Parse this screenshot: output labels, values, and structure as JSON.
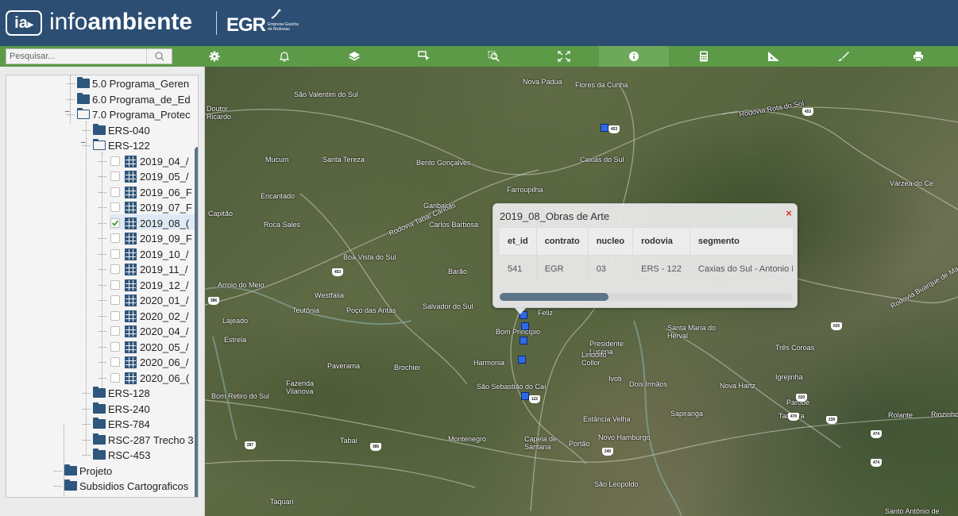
{
  "header": {
    "logo_mark": "ia",
    "brand_light": "info",
    "brand_bold": "ambiente",
    "partner": "EGR",
    "partner_sub": "Empresa Gaúcha de Rodovias"
  },
  "toolbar": {
    "search_placeholder": "Pesquisar...",
    "tools": [
      "gear-icon",
      "bell-icon",
      "layers-icon",
      "select-icon",
      "zoom-area-icon",
      "extent-icon",
      "info-icon",
      "calculator-icon",
      "measure-icon",
      "draw-icon",
      "print-icon"
    ],
    "active_tool": "info-icon"
  },
  "tree": {
    "items": [
      {
        "label": "5.0 Programa_Geren",
        "type": "folder"
      },
      {
        "label": "6.0 Programa_de_Ed",
        "type": "folder"
      },
      {
        "label": "7.0 Programa_Protec",
        "type": "folder-open"
      },
      {
        "label": "ERS-040",
        "type": "folder"
      },
      {
        "label": "ERS-122",
        "type": "folder-open"
      },
      {
        "label": "2019_04_/",
        "type": "layer",
        "checked": false
      },
      {
        "label": "2019_05_/",
        "type": "layer",
        "checked": false
      },
      {
        "label": "2019_06_F",
        "type": "layer",
        "checked": false
      },
      {
        "label": "2019_07_F",
        "type": "layer",
        "checked": false
      },
      {
        "label": "2019_08_(",
        "type": "layer",
        "checked": true
      },
      {
        "label": "2019_09_F",
        "type": "layer",
        "checked": false
      },
      {
        "label": "2019_10_/",
        "type": "layer",
        "checked": false
      },
      {
        "label": "2019_11_/",
        "type": "layer",
        "checked": false
      },
      {
        "label": "2019_12_/",
        "type": "layer",
        "checked": false
      },
      {
        "label": "2020_01_/",
        "type": "layer",
        "checked": false
      },
      {
        "label": "2020_02_/",
        "type": "layer",
        "checked": false
      },
      {
        "label": "2020_04_/",
        "type": "layer",
        "checked": false
      },
      {
        "label": "2020_05_/",
        "type": "layer",
        "checked": false
      },
      {
        "label": "2020_06_/",
        "type": "layer",
        "checked": false
      },
      {
        "label": "2020_06_(",
        "type": "layer",
        "checked": false
      },
      {
        "label": "ERS-128",
        "type": "folder"
      },
      {
        "label": "ERS-240",
        "type": "folder"
      },
      {
        "label": "ERS-784",
        "type": "folder"
      },
      {
        "label": "RSC-287 Trecho 3",
        "type": "folder"
      },
      {
        "label": "RSC-453",
        "type": "folder"
      },
      {
        "label": "Projeto",
        "type": "folder"
      },
      {
        "label": "Subsidios Cartograficos",
        "type": "folder"
      }
    ]
  },
  "map": {
    "places": [
      "Nova Pádua",
      "Flores da Cunha",
      "Doutor Ricardo",
      "São Valentim do Sul",
      "Rodovia Rota do Sol",
      "Caxias do Sul",
      "Mucum",
      "Santa Tereza",
      "Bento Gonçalves",
      "Farroupilha",
      "Várzea do Ce",
      "Encantado",
      "Garibaldi",
      "Capitão",
      "Roca Sales",
      "Carlos Barbosa",
      "Boa Vista do Sul",
      "Barão",
      "Arroio do Meio",
      "Westfália",
      "Teutônia",
      "Poço das Antas",
      "Salvador do Sul",
      "Feliz",
      "Lajeado",
      "Bom Princípio",
      "Santa Maria do Herval",
      "Estrela",
      "Presidente Lucena",
      "Três Coroas",
      "Paverama",
      "Brochier",
      "Harmonia",
      "Lindolfo Collor",
      "Ivoti",
      "Dois Irmãos",
      "Nova Hartz",
      "Igrejinha",
      "Fazenda Vilanova",
      "São Sebastião do Caí",
      "Parobé",
      "Bom Retiro do Sul",
      "Sapiranga",
      "Taquara",
      "Rolante",
      "Riozinho",
      "Estância Velha",
      "Tabaí",
      "Montenegro",
      "Capela de Santana",
      "Portão",
      "Novo Hamburgo",
      "São Leopoldo",
      "Taquari",
      "Santo Antônio de",
      "Rodovia Tabaí Canoas",
      "Rodovia Buarque de Macedo",
      "Rodovia Rota do Sol"
    ],
    "shields": [
      "453",
      "453",
      "453",
      "386",
      "386",
      "122",
      "020",
      "020",
      "239",
      "474",
      "474",
      "240",
      "287",
      "470"
    ]
  },
  "popup": {
    "title": "2019_08_Obras de Arte",
    "close": "×",
    "columns": [
      "et_id",
      "contrato",
      "nucleo",
      "rodovia",
      "segmento"
    ],
    "row": [
      "541",
      "EGR",
      "03",
      "ERS - 122",
      "Caxias do Sul - Antonio Pra"
    ],
    "scroll": 0.37
  }
}
